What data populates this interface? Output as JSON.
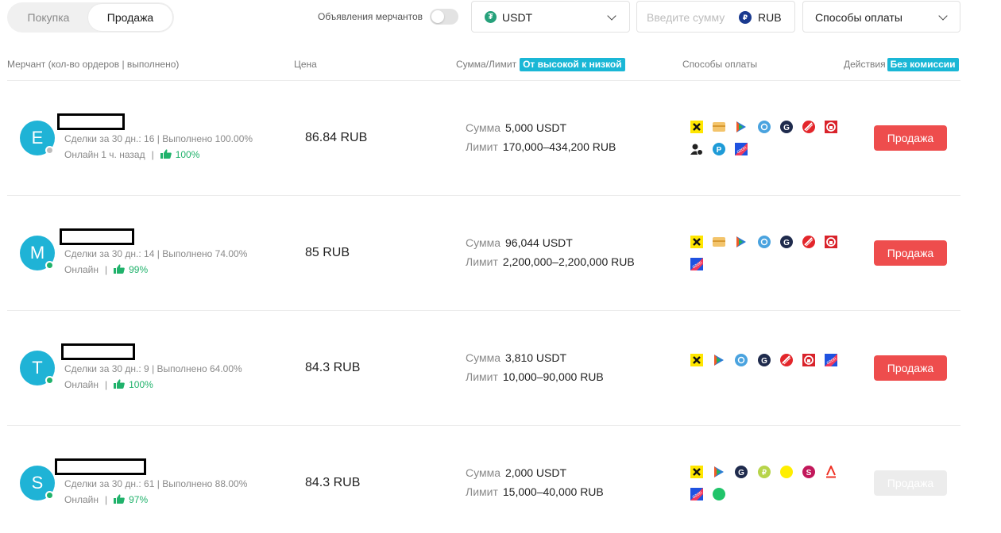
{
  "tabs": {
    "buy": "Покупка",
    "sell": "Продажа"
  },
  "filters": {
    "merchant_toggle_label": "Объявления мерчантов",
    "coin": "USDT",
    "amount_placeholder": "Введите сумму",
    "fiat": "RUB",
    "payment_methods": "Способы оплаты"
  },
  "table_header": {
    "merchant": "Мерчант (кол-во ордеров | выполнено)",
    "price": "Цена",
    "amount_limit": "Сумма/Лимит",
    "sort_badge": "От высокой к низкой",
    "payment_methods": "Способы оплаты",
    "actions": "Действия",
    "fee_badge": "Без комиссии"
  },
  "labels": {
    "amount": "Сумма",
    "limit": "Лимит",
    "separator": "|"
  },
  "colors": {
    "accent_red": "#ee4d4d",
    "badge_blue": "#1ab7d6",
    "avatar": "#1fb3d6",
    "online": "#20b26b"
  },
  "rows": [
    {
      "initial": "E",
      "online": false,
      "stats": "Сделки за 30 дн.: 16 | Выполнено 100.00%",
      "status": "Онлайн 1 ч. назад",
      "rating": "100%",
      "price": "86.84 RUB",
      "amount": "5,000 USDT",
      "limit": "170,000–434,200 RUB",
      "payment_icons": [
        [
          "raiffeisen-icon",
          "card-icon",
          "vtb-play-icon",
          "o-icon",
          "g-icon",
          "mts-icon",
          "home-icon"
        ],
        [
          "sbp-person-icon",
          "p-icon",
          "ozon-icon"
        ]
      ],
      "action": "Продажа",
      "action_enabled": true
    },
    {
      "initial": "M",
      "online": true,
      "stats": "Сделки за 30 дн.: 14 | Выполнено 74.00%",
      "status": "Онлайн",
      "rating": "99%",
      "price": "85 RUB",
      "amount": "96,044 USDT",
      "limit": "2,200,000–2,200,000 RUB",
      "payment_icons": [
        [
          "raiffeisen-icon",
          "card-icon",
          "vtb-play-icon",
          "o-icon",
          "g-icon",
          "mts-icon",
          "home-icon"
        ],
        [
          "ozon-icon"
        ]
      ],
      "action": "Продажа",
      "action_enabled": true
    },
    {
      "initial": "T",
      "online": true,
      "stats": "Сделки за 30 дн.: 9 | Выполнено 64.00%",
      "status": "Онлайн",
      "rating": "100%",
      "price": "84.3 RUB",
      "amount": "3,810 USDT",
      "limit": "10,000–90,000 RUB",
      "payment_icons": [
        [
          "raiffeisen-icon",
          "vtb-play-icon",
          "o-icon",
          "g-icon",
          "mts-icon",
          "home-icon",
          "ozon-icon"
        ]
      ],
      "action": "Продажа",
      "action_enabled": true
    },
    {
      "initial": "S",
      "online": true,
      "stats": "Сделки за 30 дн.: 61 | Выполнено 88.00%",
      "status": "Онлайн",
      "rating": "97%",
      "price": "84.3 RUB",
      "amount": "2,000 USDT",
      "limit": "15,000–40,000 RUB",
      "payment_icons": [
        [
          "raiffeisen-icon",
          "vtb-play-icon",
          "g-icon",
          "green-bank-icon",
          "yellow-circle-icon",
          "s-icon",
          "alfa-icon"
        ],
        [
          "ozon-icon",
          "green-circle-icon"
        ]
      ],
      "action": "Продажа",
      "action_enabled": false
    }
  ]
}
